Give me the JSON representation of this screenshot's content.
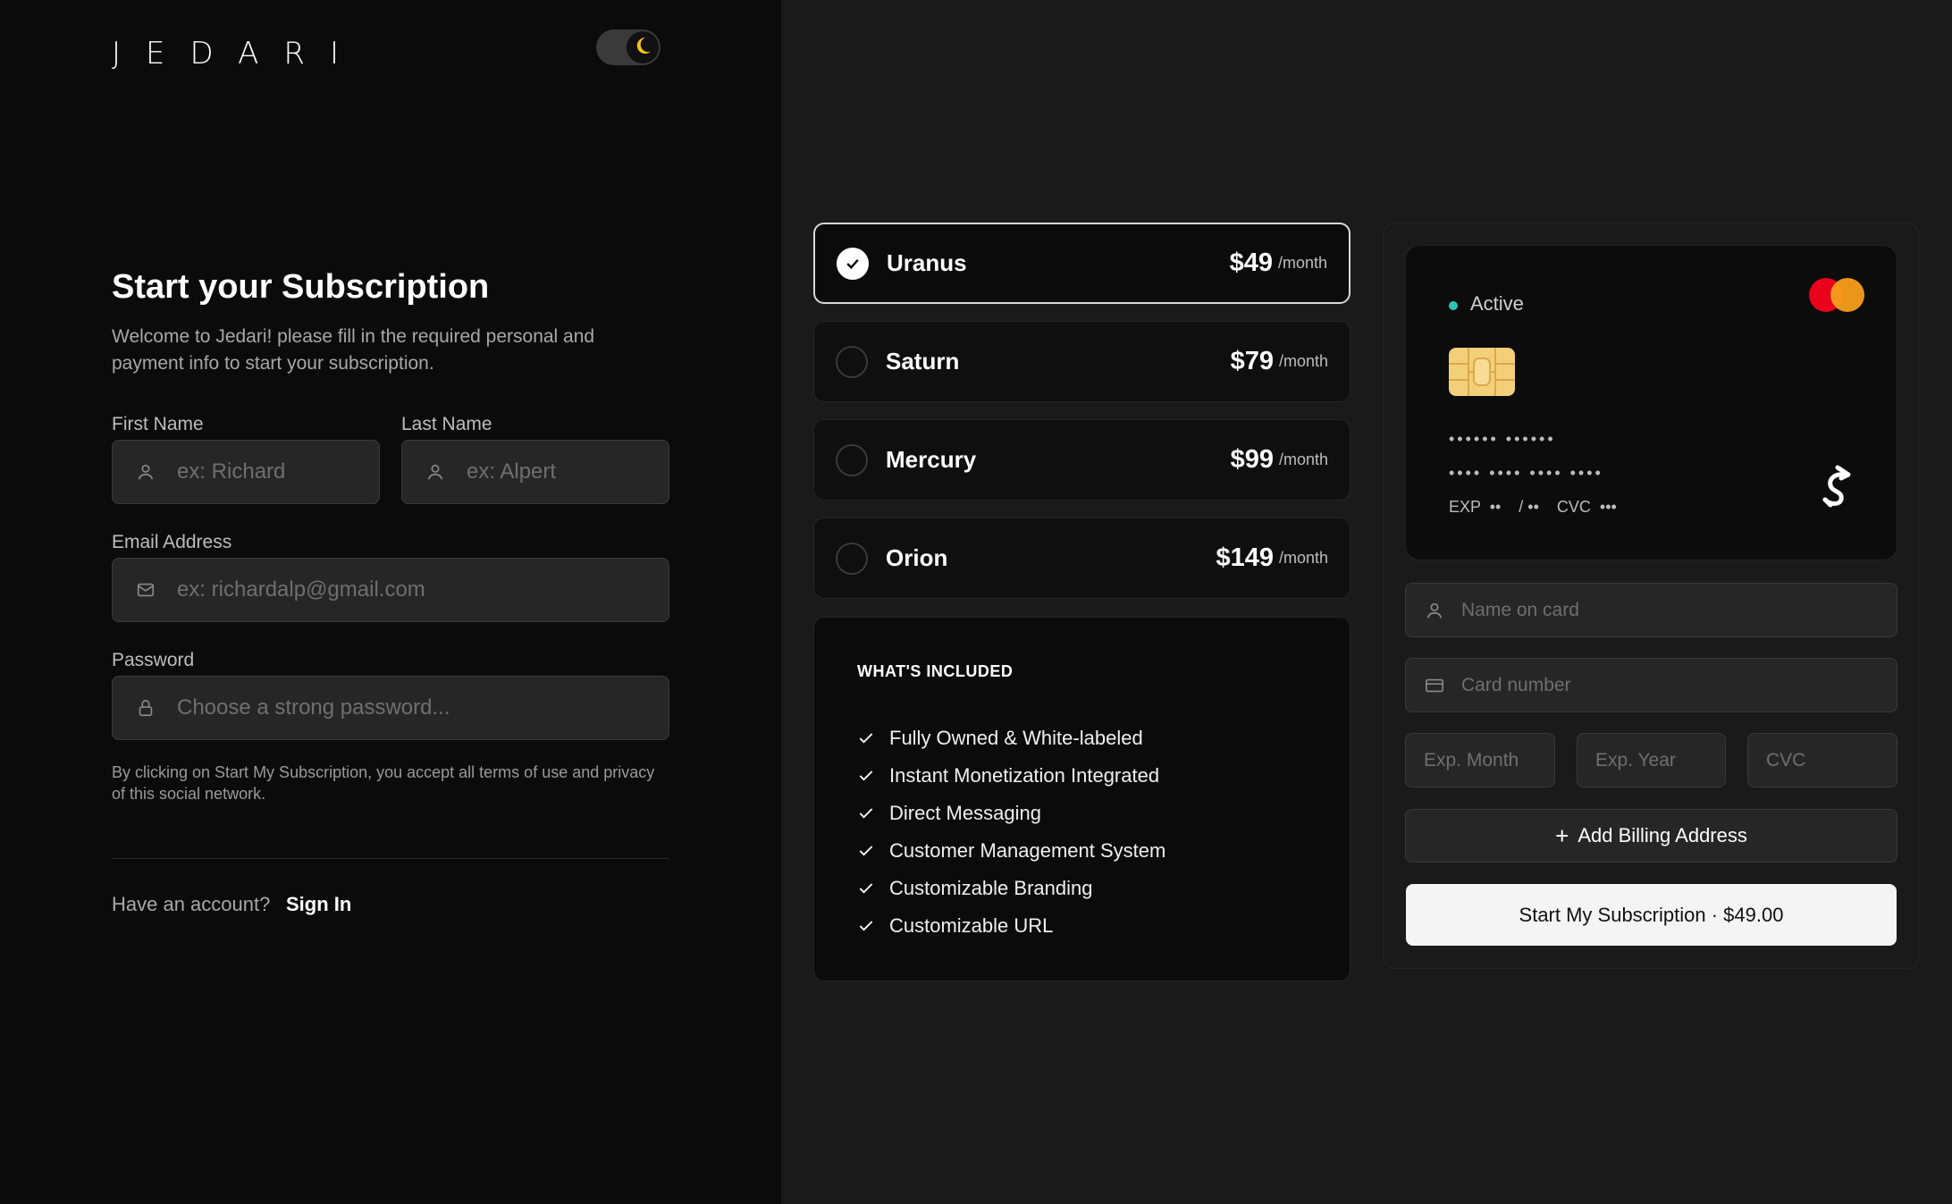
{
  "brand": {
    "logo_text": "JEDARI"
  },
  "theme_toggle": {
    "icon": "moon-icon",
    "accent": "#f5c518"
  },
  "form": {
    "heading": "Start your Subscription",
    "subtitle": "Welcome to Jedari! please fill in the required personal and payment info to start your subscription.",
    "first_name": {
      "label": "First Name",
      "placeholder": "ex: Richard",
      "icon": "user-icon"
    },
    "last_name": {
      "label": "Last Name",
      "placeholder": "ex: Alpert",
      "icon": "user-icon"
    },
    "email": {
      "label": "Email Address",
      "placeholder": "ex: richardalp@gmail.com",
      "icon": "mail-icon"
    },
    "password": {
      "label": "Password",
      "placeholder": "Choose a strong password...",
      "icon": "lock-icon"
    },
    "terms": "By clicking on Start My Subscription, you accept all terms of use and privacy of this social network.",
    "account_prompt": "Have an account?",
    "sign_in": "Sign In"
  },
  "plans": [
    {
      "name": "Uranus",
      "price": "$49",
      "period": "/month",
      "selected": true
    },
    {
      "name": "Saturn",
      "price": "$79",
      "period": "/month",
      "selected": false
    },
    {
      "name": "Mercury",
      "price": "$99",
      "period": "/month",
      "selected": false
    },
    {
      "name": "Orion",
      "price": "$149",
      "period": "/month",
      "selected": false
    }
  ],
  "included": {
    "title": "WHAT'S INCLUDED",
    "items": [
      "Fully Owned & White-labeled",
      "Instant Monetization Integrated",
      "Direct Messaging",
      "Customer Management System",
      "Customizable Branding",
      "Customizable URL"
    ]
  },
  "card_preview": {
    "status": "Active",
    "status_color": "#2ec4b6",
    "name_mask": "•••••• ••••••",
    "number_mask": "•••• •••• •••• ••••",
    "exp_line": "EXP  ••    / ••    CVC  •••"
  },
  "payment": {
    "name_on_card": {
      "placeholder": "Name on card",
      "icon": "user-icon"
    },
    "card_number": {
      "placeholder": "Card number",
      "icon": "credit-card-icon"
    },
    "exp_month": {
      "placeholder": "Exp. Month"
    },
    "exp_year": {
      "placeholder": "Exp. Year"
    },
    "cvc": {
      "placeholder": "CVC"
    },
    "add_billing": "Add Billing Address",
    "start_button": "Start My Subscription · $49.00"
  }
}
